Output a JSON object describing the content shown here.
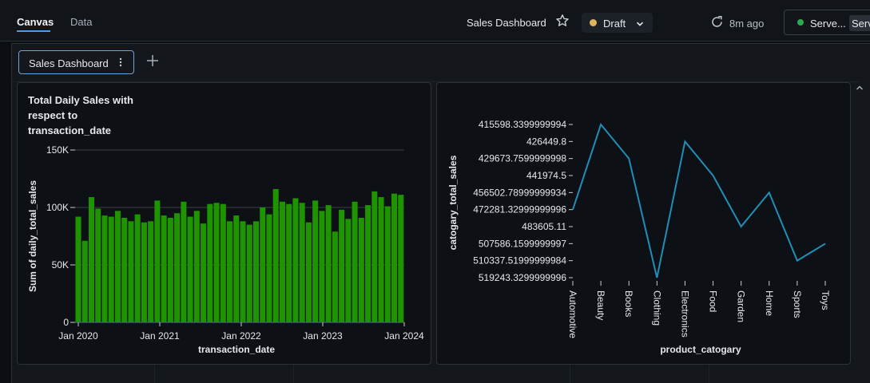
{
  "header": {
    "tabs": [
      {
        "label": "Canvas",
        "active": true
      },
      {
        "label": "Data",
        "active": false
      }
    ],
    "dashboard_title": "Sales Dashboard",
    "draft_label": "Draft",
    "draft_color": "#e0b35d",
    "refresh_time": "8m ago",
    "server_label": "Serve...",
    "server_chip": "Serverless",
    "server_status_color": "#2fa84f"
  },
  "page_tab": {
    "label": "Sales Dashboard"
  },
  "icons": [
    "star-icon",
    "chevron-down-icon",
    "refresh-icon",
    "kebab-menu-icon",
    "plus-icon",
    "chevron-up-icon"
  ],
  "chart_data": [
    {
      "type": "bar",
      "title": "Total Daily Sales with respect to transaction_date",
      "xlabel": "transaction_date",
      "ylabel": "Sum of daily_total_sales",
      "yticks": [
        "0",
        "50K",
        "100K",
        "150K"
      ],
      "ylim": [
        0,
        150000
      ],
      "xticks": [
        "Jan 2020",
        "Jan 2021",
        "Jan 2022",
        "Jan 2023",
        "Jan 2024"
      ],
      "bar_color": "#1e9400",
      "grid": true,
      "values": [
        92000,
        71000,
        109000,
        99000,
        93000,
        92000,
        97000,
        91000,
        88000,
        94000,
        87000,
        88000,
        106000,
        93000,
        91000,
        95000,
        105000,
        92000,
        97000,
        86000,
        103000,
        104000,
        103000,
        88000,
        93000,
        88000,
        85000,
        88000,
        100000,
        94000,
        116000,
        105000,
        103000,
        108000,
        104000,
        87000,
        106000,
        97000,
        102000,
        79000,
        98000,
        90000,
        105000,
        91000,
        102000,
        114000,
        109000,
        101000,
        112000,
        111000
      ]
    },
    {
      "type": "line",
      "xlabel": "product_catogary",
      "ylabel": "catogary_total_sales",
      "line_color": "#1f8fb8",
      "yticks": [
        "415598.3399999994",
        "426449.8",
        "429673.7599999998",
        "441974.5",
        "456502.78999999934",
        "472281.32999999996",
        "483605.11",
        "507586.1599999997",
        "510337.51999999984",
        "519243.3299999996"
      ],
      "categories": [
        "Automotive",
        "Beauty",
        "Books",
        "Clothing",
        "Electronics",
        "Food",
        "Garden",
        "Home",
        "Sports",
        "Toys"
      ],
      "values": [
        472281.32999999996,
        415598.3399999994,
        429673.7599999998,
        519243.3299999996,
        426449.8,
        441974.5,
        483605.11,
        456502.78999999934,
        510337.51999999984,
        507586.1599999997
      ]
    }
  ]
}
